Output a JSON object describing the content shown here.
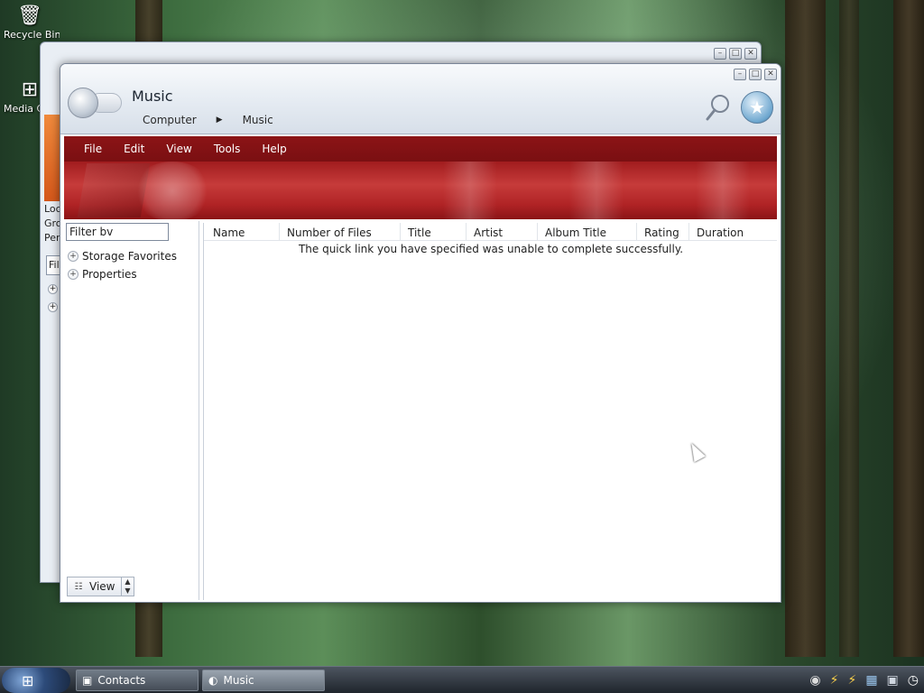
{
  "desktop": {
    "icons": [
      {
        "label": "Recycle Bin",
        "icon": "recycle-bin-icon"
      },
      {
        "label": "Media C",
        "icon": "media-center-icon"
      }
    ]
  },
  "background_window": {
    "lines": [
      "Loc",
      "Gro",
      "Per"
    ],
    "field": "Fil"
  },
  "window": {
    "title": "Music",
    "breadcrumb": [
      "Computer",
      "Music"
    ],
    "controls": {
      "minimize": "–",
      "maximize": "□",
      "close": "✕"
    }
  },
  "menu": {
    "items": [
      "File",
      "Edit",
      "View",
      "Tools",
      "Help"
    ]
  },
  "sidebar": {
    "filter_value": "Filter bv",
    "tree": [
      "Storage Favorites",
      "Properties"
    ],
    "view_label": "View"
  },
  "table": {
    "columns": [
      "Name",
      "Number of Files",
      "Title",
      "Artist",
      "Album Title",
      "Rating",
      "Duration"
    ],
    "message": "The quick link you have specified was unable to complete successfully."
  },
  "taskbar": {
    "tasks": [
      "Contacts",
      "Music"
    ],
    "active_task": "Music"
  },
  "colors": {
    "menubar": "#7a0f12",
    "banner": "#b02325",
    "accent": "#3a6f99"
  }
}
